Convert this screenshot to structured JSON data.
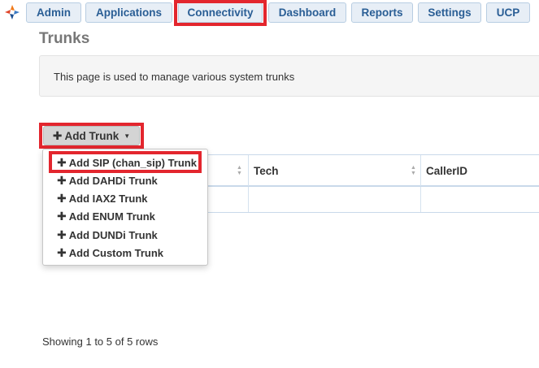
{
  "nav": {
    "tabs": [
      {
        "label": "Admin"
      },
      {
        "label": "Applications"
      },
      {
        "label": "Connectivity"
      },
      {
        "label": "Dashboard"
      },
      {
        "label": "Reports"
      },
      {
        "label": "Settings"
      },
      {
        "label": "UCP"
      }
    ],
    "active_tab": "Connectivity"
  },
  "page": {
    "title": "Trunks",
    "description": "This page is used to manage various system trunks"
  },
  "add_trunk": {
    "label": "Add Trunk",
    "menu": [
      {
        "label": "Add SIP (chan_sip) Trunk"
      },
      {
        "label": "Add DAHDi Trunk"
      },
      {
        "label": "Add IAX2 Trunk"
      },
      {
        "label": "Add ENUM Trunk"
      },
      {
        "label": "Add DUNDi Trunk"
      },
      {
        "label": "Add Custom Trunk"
      }
    ]
  },
  "table": {
    "columns": [
      "Tech",
      "CallerID"
    ]
  },
  "footer": {
    "pagination_text": "Showing 1 to 5 of 5 rows"
  },
  "colors": {
    "highlight": "#e3262e",
    "tab_text": "#2a5e95",
    "tab_bg": "#e7eef6"
  }
}
